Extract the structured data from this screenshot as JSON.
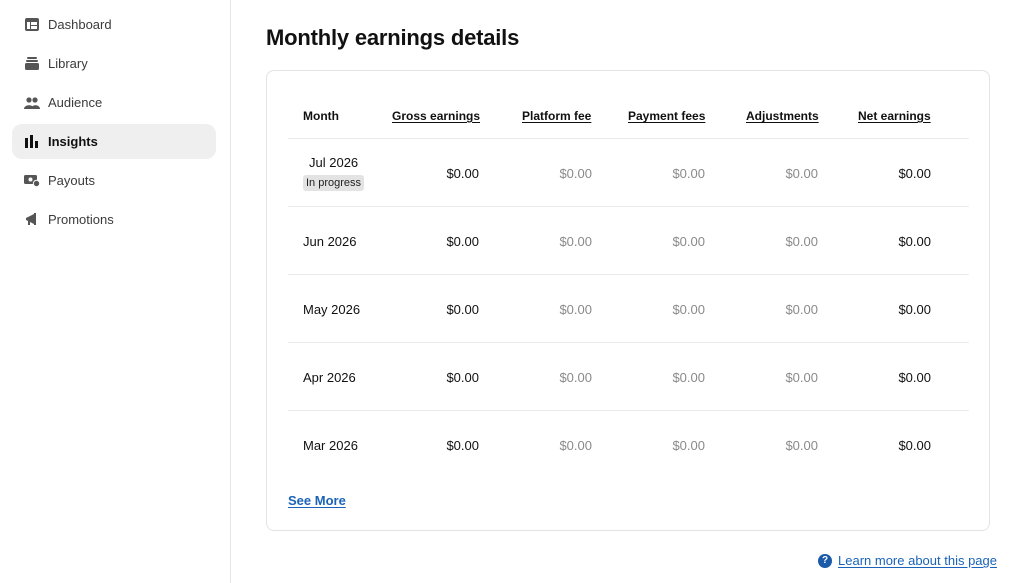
{
  "sidebar": {
    "items": [
      {
        "label": "Dashboard",
        "icon": "dashboard-icon",
        "active": false
      },
      {
        "label": "Library",
        "icon": "library-icon",
        "active": false
      },
      {
        "label": "Audience",
        "icon": "audience-icon",
        "active": false
      },
      {
        "label": "Insights",
        "icon": "insights-icon",
        "active": true
      },
      {
        "label": "Payouts",
        "icon": "payouts-icon",
        "active": false
      },
      {
        "label": "Promotions",
        "icon": "promotions-icon",
        "active": false
      }
    ]
  },
  "main": {
    "title": "Monthly earnings details",
    "table": {
      "columns": [
        "Month",
        "Gross earnings",
        "Platform fee",
        "Payment fees",
        "Adjustments",
        "Net earnings"
      ],
      "rows": [
        {
          "month": "Jul 2026",
          "badge": "In progress",
          "gross": "$0.00",
          "platform": "$0.00",
          "payment": "$0.00",
          "adjustments": "$0.00",
          "net": "$0.00"
        },
        {
          "month": "Jun 2026",
          "gross": "$0.00",
          "platform": "$0.00",
          "payment": "$0.00",
          "adjustments": "$0.00",
          "net": "$0.00"
        },
        {
          "month": "May 2026",
          "gross": "$0.00",
          "platform": "$0.00",
          "payment": "$0.00",
          "adjustments": "$0.00",
          "net": "$0.00"
        },
        {
          "month": "Apr 2026",
          "gross": "$0.00",
          "platform": "$0.00",
          "payment": "$0.00",
          "adjustments": "$0.00",
          "net": "$0.00"
        },
        {
          "month": "Mar 2026",
          "gross": "$0.00",
          "platform": "$0.00",
          "payment": "$0.00",
          "adjustments": "$0.00",
          "net": "$0.00"
        }
      ]
    },
    "see_more": "See More",
    "help_link": "Learn more about this page"
  },
  "colors": {
    "link": "#1a63b8",
    "active_bg": "#efefef",
    "muted": "#8a8a8a"
  }
}
